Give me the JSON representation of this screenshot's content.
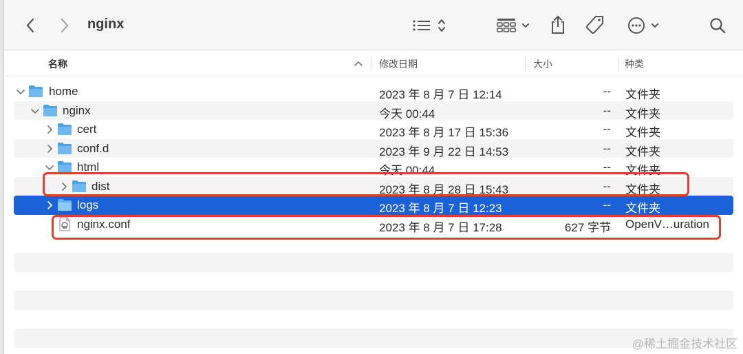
{
  "window": {
    "title": "nginx",
    "colors": {
      "selection": "#1b62d8",
      "highlight_box": "#e0412e",
      "folder": "#4aa3e8",
      "stripe": "#f4f4f4"
    }
  },
  "toolbar": {
    "icons": [
      "back-chevron-icon",
      "forward-chevron-icon",
      "list-view-icon",
      "sort-updown-icon",
      "group-grid-icon",
      "chevron-down-icon",
      "share-icon",
      "tag-icon",
      "more-icon",
      "chevron-down-icon",
      "search-icon"
    ]
  },
  "columns": {
    "name": "名称",
    "date": "修改日期",
    "size": "大小",
    "kind": "种类"
  },
  "rows": [
    {
      "name": "home",
      "date": "2023 年 8 月 7 日 12:14",
      "size": "--",
      "kind": "文件夹",
      "depth": 0,
      "expanded": true,
      "type": "folder"
    },
    {
      "name": "nginx",
      "date": "今天 00:44",
      "size": "--",
      "kind": "文件夹",
      "depth": 1,
      "expanded": true,
      "type": "folder"
    },
    {
      "name": "cert",
      "date": "2023 年 8 月 17 日 15:36",
      "size": "--",
      "kind": "文件夹",
      "depth": 2,
      "expanded": false,
      "type": "folder"
    },
    {
      "name": "conf.d",
      "date": "2023 年 9 月 22 日 14:53",
      "size": "--",
      "kind": "文件夹",
      "depth": 2,
      "expanded": false,
      "type": "folder"
    },
    {
      "name": "html",
      "date": "今天 00:44",
      "size": "--",
      "kind": "文件夹",
      "depth": 2,
      "expanded": true,
      "type": "folder"
    },
    {
      "name": "dist",
      "date": "2023 年 8 月 28 日 15:43",
      "size": "--",
      "kind": "文件夹",
      "depth": 3,
      "expanded": false,
      "type": "folder"
    },
    {
      "name": "logs",
      "date": "2023 年 8 月 7 日 12:23",
      "size": "--",
      "kind": "文件夹",
      "depth": 2,
      "expanded": false,
      "type": "folder",
      "selected": true
    },
    {
      "name": "nginx.conf",
      "date": "2023 年 8 月 7 日 17:28",
      "size": "627 字节",
      "kind": "OpenV…uration",
      "depth": 2,
      "type": "file"
    }
  ],
  "watermark": "@稀土掘金技术社区"
}
